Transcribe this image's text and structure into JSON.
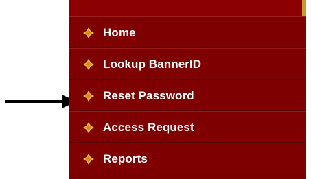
{
  "menu": {
    "items": [
      {
        "label": "Home",
        "icon": "diamond-bullet-icon"
      },
      {
        "label": "Lookup BannerID",
        "icon": "diamond-bullet-icon"
      },
      {
        "label": "Reset Password",
        "icon": "diamond-bullet-icon"
      },
      {
        "label": "Access Request",
        "icon": "diamond-bullet-icon"
      },
      {
        "label": "Reports",
        "icon": "diamond-bullet-icon"
      }
    ]
  },
  "annotation": {
    "pointer": "arrow-right-icon",
    "points_to": "Reset Password"
  },
  "colors": {
    "menu_background": "#7f0000",
    "menu_text": "#ffffff",
    "bullet_yellow": "#f2c233",
    "bullet_orange": "#d98a1a",
    "arrow": "#000000"
  }
}
